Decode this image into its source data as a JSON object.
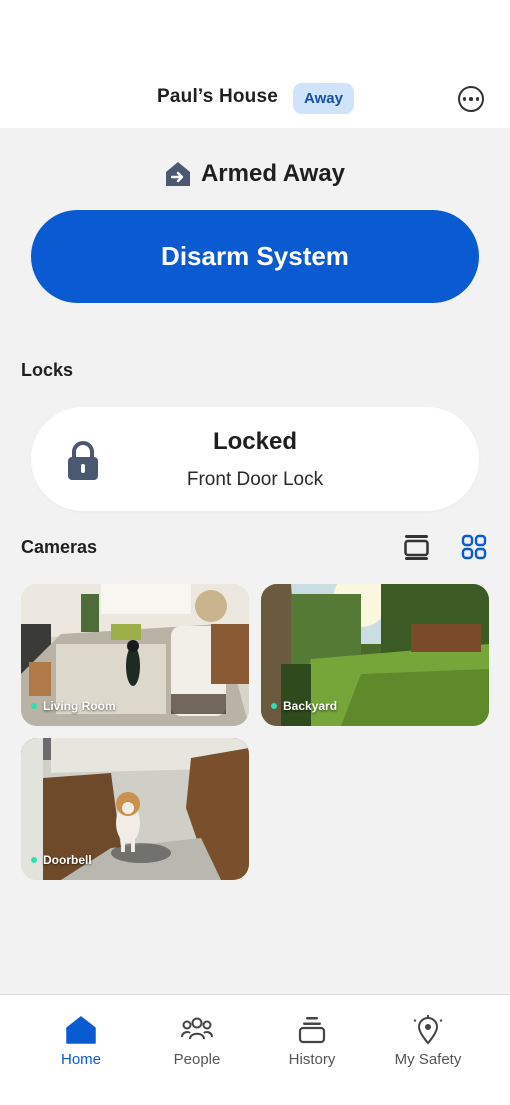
{
  "header": {
    "house_name": "Paul’s House",
    "status_badge": "Away",
    "more_icon": "more-horizontal-icon"
  },
  "security": {
    "status": "Armed Away",
    "status_icon": "house-arrow-icon",
    "action_label": "Disarm System"
  },
  "locks": {
    "section_title": "Locks",
    "items": [
      {
        "status": "Locked",
        "name": "Front Door Lock",
        "icon": "padlock-icon"
      }
    ]
  },
  "cameras": {
    "section_title": "Cameras",
    "view_modes": [
      "list-view-icon",
      "grid-view-icon"
    ],
    "selected_view": "grid",
    "items": [
      {
        "name": "Living Room",
        "live": true
      },
      {
        "name": "Backyard",
        "live": true
      },
      {
        "name": "Doorbell",
        "live": true
      }
    ]
  },
  "tabbar": {
    "items": [
      {
        "label": "Home",
        "icon": "home-icon",
        "active": true
      },
      {
        "label": "People",
        "icon": "people-icon",
        "active": false
      },
      {
        "label": "History",
        "icon": "history-stack-icon",
        "active": false
      },
      {
        "label": "My Safety",
        "icon": "location-pin-icon",
        "active": false
      }
    ]
  },
  "colors": {
    "primary": "#0a5bd1",
    "badge_bg": "#cfe3fb",
    "badge_text": "#1650a6",
    "background": "#f2f2f2",
    "icon_slate": "#4b5872",
    "live_dot": "#2ee0b0"
  }
}
